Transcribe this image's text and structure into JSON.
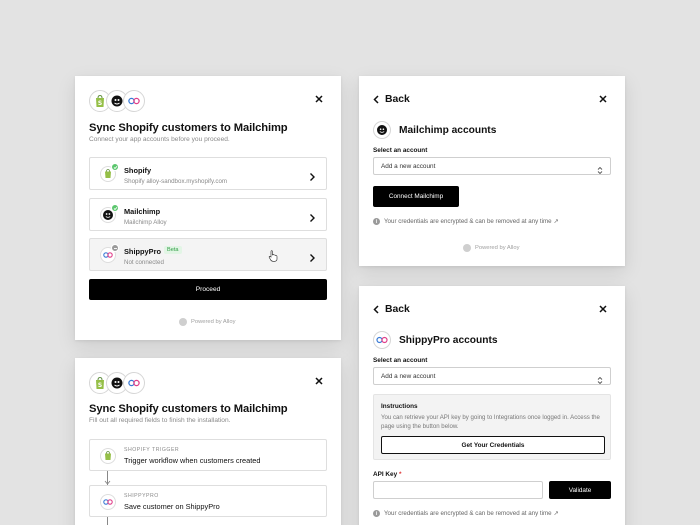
{
  "sync_card": {
    "title": "Sync Shopify customers to Mailchimp",
    "subtitle": "Connect your app accounts before you proceed.",
    "apps": [
      {
        "name": "Shopify",
        "sub": "Shopify alloy-sandbox.myshopify.com",
        "status": "connected",
        "icon": "shopify-icon"
      },
      {
        "name": "Mailchimp",
        "sub": "Mailchimp Alloy",
        "status": "connected",
        "icon": "mailchimp-icon"
      },
      {
        "name": "ShippyPro",
        "sub": "Not connected",
        "status": "not-connected",
        "tag": "Beta",
        "icon": "shippypro-icon"
      }
    ],
    "proceed_label": "Proceed",
    "powered_by": "Powered by Alloy"
  },
  "mailchimp_card": {
    "back_label": "Back",
    "title": "Mailchimp accounts",
    "select_label": "Select an account",
    "select_value": "Add a new account",
    "connect_label": "Connect Mailchimp",
    "note": "Your credentials are encrypted & can be removed at any time ↗",
    "powered_by": "Powered by Alloy"
  },
  "shippy_card": {
    "back_label": "Back",
    "title": "ShippyPro accounts",
    "select_label": "Select an account",
    "select_value": "Add a new account",
    "instructions_title": "Instructions",
    "instructions_text": "You can retrieve your API key by going to Integrations once logged in. Access the page using the button below.",
    "credentials_button": "Get Your Credentials",
    "api_key_label": "API Key",
    "api_key_required": "*",
    "validate_label": "Validate",
    "note": "Your credentials are encrypted & can be removed at any time ↗"
  },
  "install_card": {
    "title": "Sync Shopify customers to Mailchimp",
    "subtitle": "Fill out all required fields to finish the installation.",
    "steps": [
      {
        "label": "SHOPIFY TRIGGER",
        "name": "Trigger workflow when customers created",
        "icon": "shopify-icon"
      },
      {
        "label": "SHIPPYPRO",
        "name": "Save customer on ShippyPro",
        "icon": "shippypro-icon"
      }
    ]
  },
  "colors": {
    "accent": "#000000",
    "success": "#5cc66e",
    "beta_text": "#2f9d44",
    "shopify": "#95bf47",
    "shippy_blue": "#3a7bd5",
    "shippy_pink": "#e0408a"
  }
}
